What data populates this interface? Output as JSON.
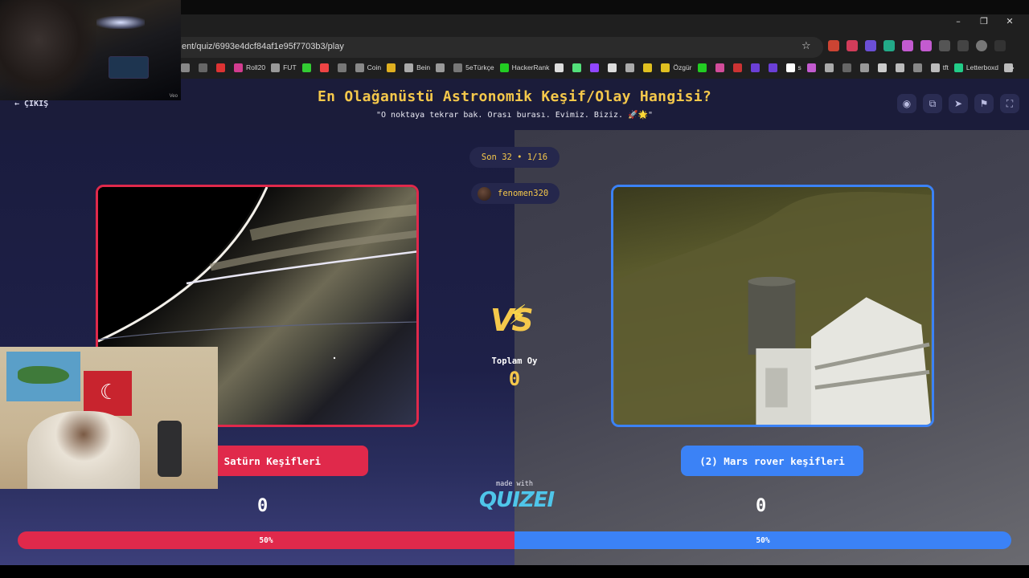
{
  "browser": {
    "url": "ent/quiz/6993e4dcf84af1e95f7703b3/play",
    "window_controls": [
      "–",
      "❐",
      "✕"
    ],
    "bookmarks": [
      "",
      "",
      "",
      "Roll20",
      "FUT",
      "",
      "",
      "",
      "Coin",
      "",
      "Bein",
      "",
      "5eTürkçe",
      "HackerRank",
      "",
      "",
      "",
      "",
      "",
      "",
      "Özgür",
      "",
      "",
      "",
      "",
      "",
      "s",
      "",
      "",
      "",
      "",
      "",
      "",
      "",
      "tft",
      "Letterboxd",
      ""
    ],
    "bookmarks_more": "»"
  },
  "header": {
    "exit_label": "ÇIKIŞ",
    "title": "En Olağanüstü Astronomik Keşif/Olay Hangisi?",
    "subtitle": "\"O noktaya tekrar bak. Orası burası. Evimiz. Biziz. 🚀🌟\"",
    "icons": [
      "eye-icon",
      "copy-icon",
      "send-icon",
      "flag-icon",
      "fullscreen-icon"
    ]
  },
  "round": {
    "label": "Son 32 • 1/16"
  },
  "creator": {
    "name": "fenomen320"
  },
  "vs": {
    "label": "VS"
  },
  "total": {
    "label": "Toplam Oy",
    "value": "0"
  },
  "choices": {
    "left": {
      "label": "ni - Satürn Keşifleri",
      "score": "0",
      "percent": 50,
      "percent_label": "50%",
      "color": "#e0294b"
    },
    "right": {
      "label": "(2) Mars rover keşifleri",
      "score": "0",
      "percent": 50,
      "percent_label": "50%",
      "color": "#3b82f6"
    }
  },
  "branding": {
    "made_with": "made with",
    "logo": "QUIZEI"
  },
  "webcam": {
    "tag": "Veo"
  }
}
